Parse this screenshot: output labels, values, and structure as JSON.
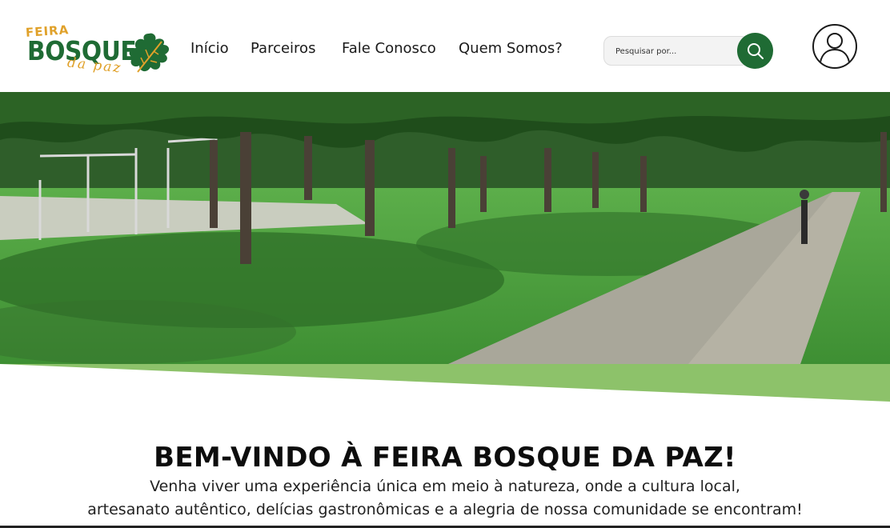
{
  "logo": {
    "top_word": "FEIRA",
    "main_word": "BOSQUE",
    "script_word": "da paz",
    "brand_green": "#1f6b34",
    "brand_orange": "#e0a12a"
  },
  "nav": {
    "items": [
      {
        "label": "Início"
      },
      {
        "label": "Parceiros"
      },
      {
        "label": "Fale Conosco"
      },
      {
        "label": "Quem Somos?"
      }
    ]
  },
  "search": {
    "placeholder": "Pesquisar por...",
    "icon": "search-icon",
    "button_color": "#1f6b34"
  },
  "account": {
    "icon": "user-icon"
  },
  "hero": {
    "image": "park-with-trees-and-walkway",
    "band_color": "#8dc26a"
  },
  "welcome": {
    "title": "BEM-VINDO À FEIRA BOSQUE DA PAZ!",
    "line1": "Venha viver uma experiência única em meio à natureza, onde a cultura local,",
    "line2": "artesanato autêntico, delícias gastronômicas e a alegria de nossa comunidade se encontram!"
  }
}
